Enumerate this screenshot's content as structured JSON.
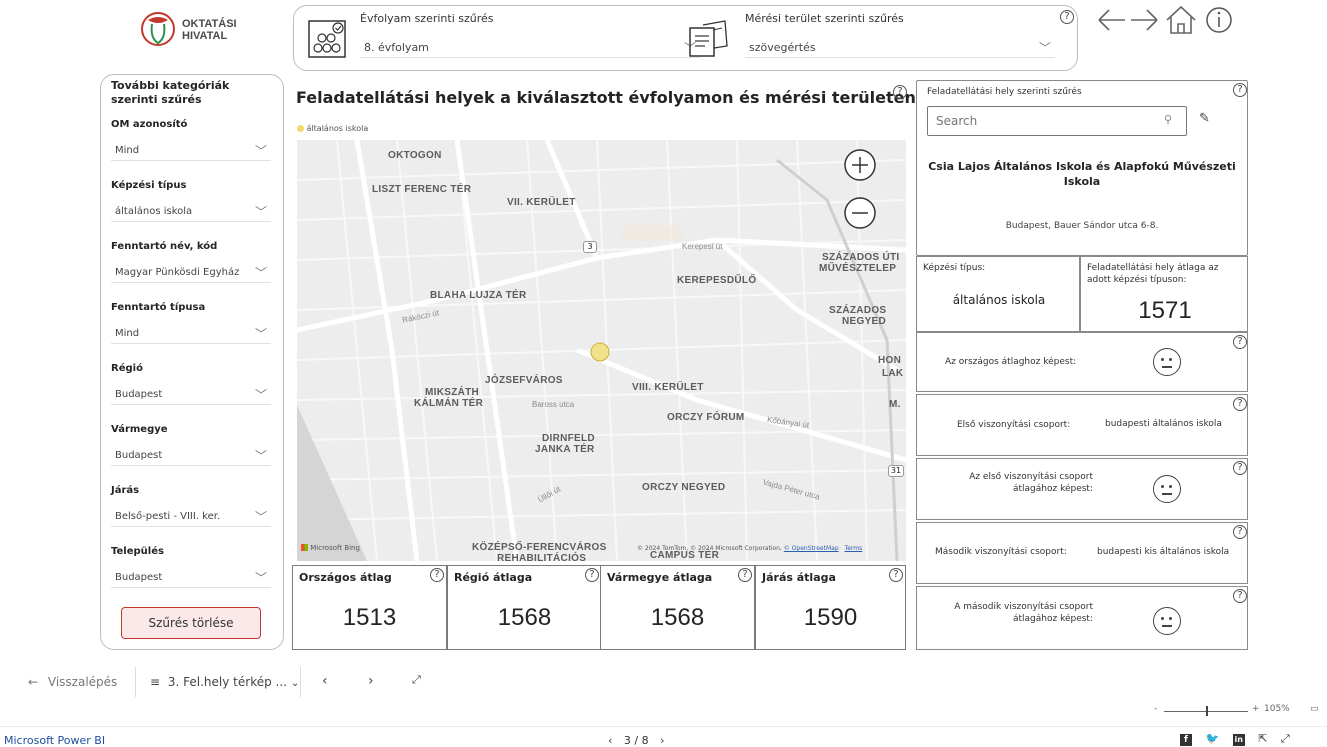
{
  "logo": {
    "line1": "OKTATÁSI",
    "line2": "HIVATAL"
  },
  "filters_top": {
    "grade": {
      "label": "Évfolyam szerinti szűrés",
      "value": "8. évfolyam"
    },
    "area": {
      "label": "Mérési terület szerinti szűrés",
      "value": "szövegértés"
    },
    "help": "?"
  },
  "nav_icons": {
    "back": "arrow-left-icon",
    "forward": "arrow-right-icon",
    "home": "home-icon",
    "info": "info-icon"
  },
  "sidebar": {
    "title": "További kategóriák szerinti szűrés",
    "filters": [
      {
        "label": "OM azonosító",
        "value": "Mind"
      },
      {
        "label": "Képzési típus",
        "value": "általános iskola"
      },
      {
        "label": "Fenntartó név, kód",
        "value": "Magyar Pünkösdi Egyház"
      },
      {
        "label": "Fenntartó típusa",
        "value": "Mind"
      },
      {
        "label": "Régió",
        "value": "Budapest"
      },
      {
        "label": "Vármegye",
        "value": "Budapest"
      },
      {
        "label": "Járás",
        "value": "Belső-pesti - VIII. ker."
      },
      {
        "label": "Település",
        "value": "Budapest"
      }
    ],
    "clear_button": "Szűrés törlése"
  },
  "map": {
    "title": "Feladatellátási helyek a kiválasztott évfolyamon és mérési területen",
    "legend": "általános iskola",
    "legend_color": "#f2d86b",
    "labels": {
      "oktogon": "OKTOGON",
      "liszt": "LISZT FERENC TÉR",
      "vii": "VII. KERÜLET",
      "szazados_uti_1": "SZÁZADOS ÚTI",
      "szazados_uti_2": "MŰVÉSZTELEP",
      "kerepesdulo": "KEREPESDŰLŐ",
      "blaha": "BLAHA LUJZA TÉR",
      "szazados_negyed_1": "SZÁZADOS",
      "szazados_negyed_2": "NEGYED",
      "hon": "HON",
      "lak": "LAK",
      "jozsefvaros": "JÓZSEFVÁROS",
      "viii": "VIII. KERÜLET",
      "mikszath_1": "MIKSZÁTH",
      "mikszath_2": "KÁLMÁN TÉR",
      "m": "M.",
      "orczy_forum": "ORCZY FÓRUM",
      "dirnfeld_1": "DIRNFELD",
      "dirnfeld_2": "JANKA TÉR",
      "orczy_negyed": "ORCZY NEGYED",
      "kozepso_1": "KÖZÉPSŐ-FERENCVÁROS",
      "kozepso_2": "REHABILITÁCIÓS",
      "campus": "CAMPUS TÉR",
      "road_3": "3",
      "road_31": "31",
      "kerepesi_ut": "Kerepesi út",
      "rakoczi_ut": "Rákóczi út",
      "baross_utca": "Baross utca",
      "kobanyai_ut": "Kőbányai út",
      "ulloi_ut": "Üllői út",
      "vajda_peter": "Vajda Péter utca"
    },
    "bing": "Microsoft Bing",
    "copyright": "© 2024 TomTom, © 2024 Microsoft Corporation,",
    "osm": "© OpenStreetMap",
    "terms": "Terms"
  },
  "averages": [
    {
      "label": "Országos átlag",
      "value": "1513"
    },
    {
      "label": "Régió átlaga",
      "value": "1568"
    },
    {
      "label": "Vármegye átlaga",
      "value": "1568"
    },
    {
      "label": "Járás átlaga",
      "value": "1590"
    }
  ],
  "right": {
    "filter_label": "Feladatellátási hely szerinti szűrés",
    "search_placeholder": "Search",
    "school_name": "Csia Lajos Általános Iskola és Alapfokú Művészeti Iskola",
    "address": "Budapest, Bauer Sándor utca 6-8.",
    "type_label": "Képzési típus:",
    "type_value": "általános iskola",
    "avg_label": "Feladatellátási hely átlaga az adott képzési típuson:",
    "avg_value": "1571",
    "national_compare": "Az országos átlaghoz képest:",
    "first_group_label": "Első viszonyítási csoport:",
    "first_group_value": "budapesti általános iskola",
    "first_group_compare": "Az első viszonyítási csoport átlagához képest:",
    "second_group_label": "Második viszonyítási csoport:",
    "second_group_value": "budapesti kis általános iskola",
    "second_group_compare": "A második viszonyítási csoport átlagához képest:"
  },
  "pbi_nav": {
    "back": "Visszalépés",
    "page_label": "3. Fel.hely térkép ...",
    "zoom": "105%",
    "brand": "Microsoft Power BI",
    "page_counter": "3 / 8"
  }
}
